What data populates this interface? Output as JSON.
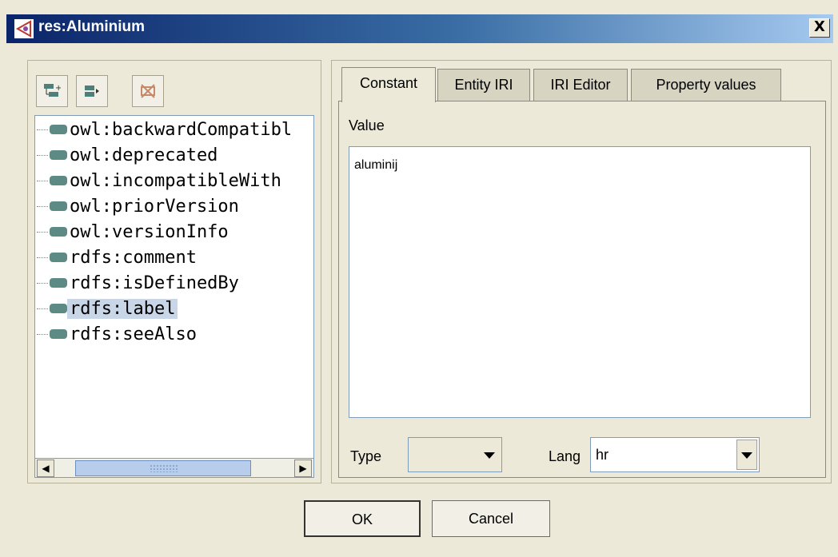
{
  "window": {
    "title": "res:Aluminium",
    "close_label": "X"
  },
  "tree": {
    "items": [
      {
        "label": "owl:backwardCompatibl",
        "selected": false
      },
      {
        "label": "owl:deprecated",
        "selected": false
      },
      {
        "label": "owl:incompatibleWith",
        "selected": false
      },
      {
        "label": "owl:priorVersion",
        "selected": false
      },
      {
        "label": "owl:versionInfo",
        "selected": false
      },
      {
        "label": "rdfs:comment",
        "selected": false
      },
      {
        "label": "rdfs:isDefinedBy",
        "selected": false
      },
      {
        "label": "rdfs:label",
        "selected": true
      },
      {
        "label": "rdfs:seeAlso",
        "selected": false
      }
    ]
  },
  "tabs": [
    "Constant",
    "Entity IRI",
    "IRI Editor",
    "Property values"
  ],
  "constant": {
    "value_label": "Value",
    "value_text": "aluminij",
    "type_label": "Type",
    "type_value": "",
    "lang_label": "Lang",
    "lang_value": "hr"
  },
  "buttons": {
    "ok": "OK",
    "cancel": "Cancel"
  },
  "colors": {
    "title_start": "#0a246a",
    "title_end": "#a6caf0",
    "selection": "#c8d6e8",
    "chip": "#5e8a86"
  }
}
